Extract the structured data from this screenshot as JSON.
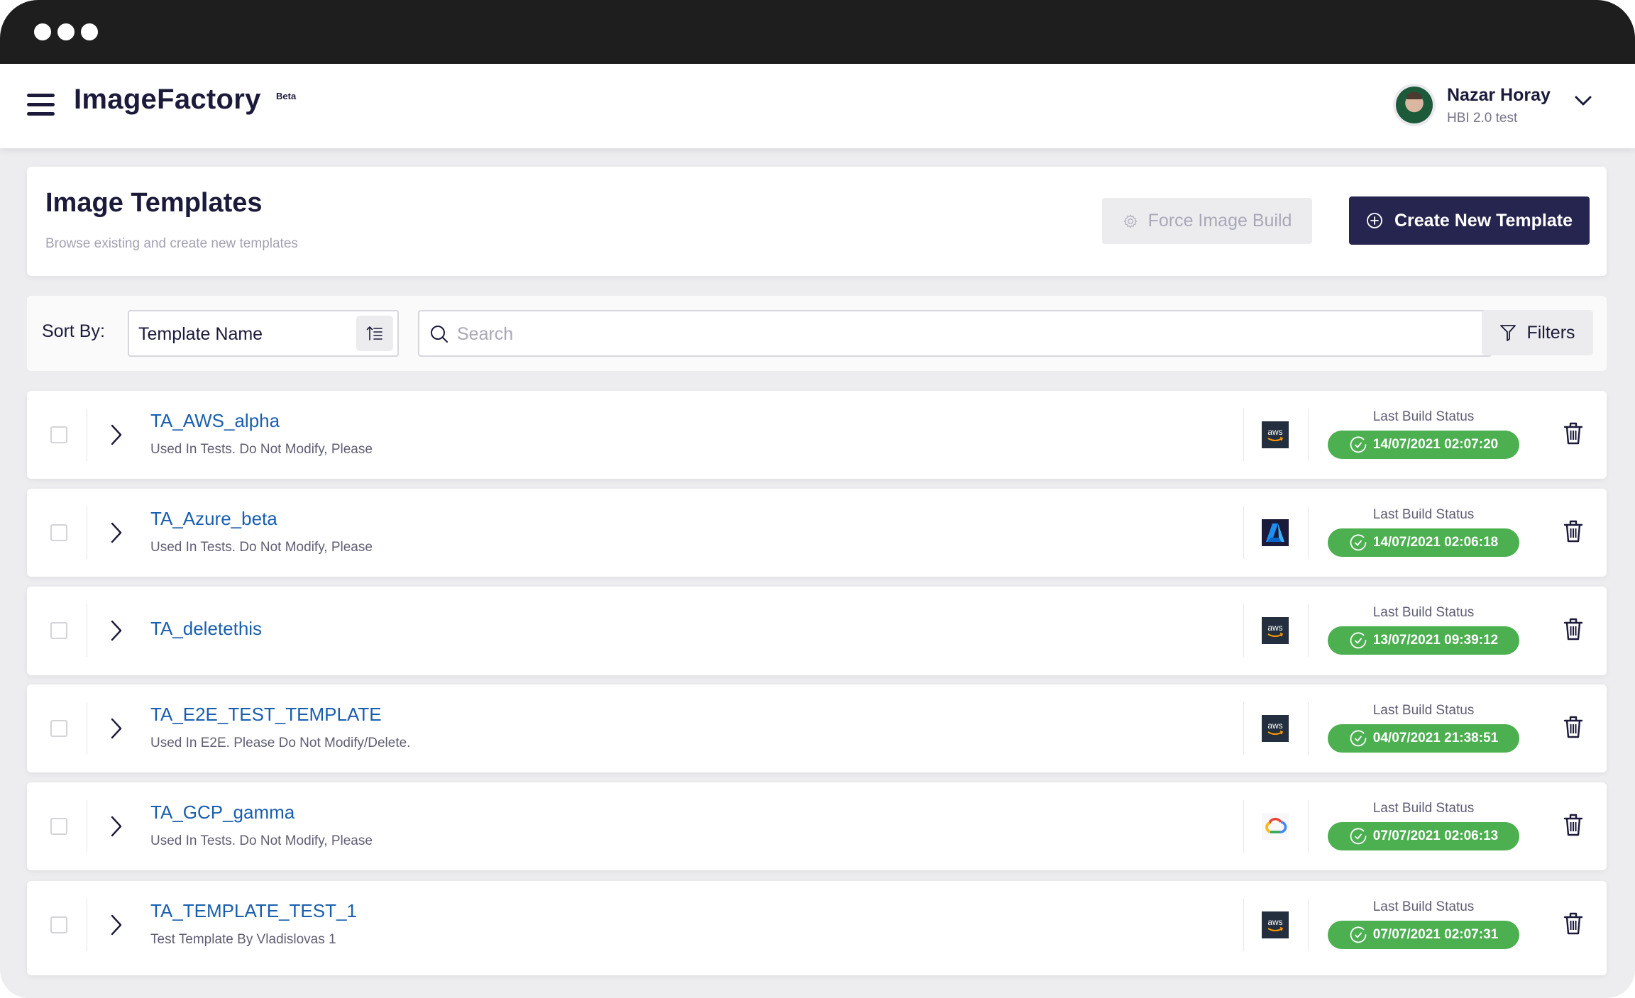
{
  "window": {
    "controls": [
      "window-dot",
      "window-dot",
      "window-dot"
    ]
  },
  "header": {
    "brand": "ImageFactory",
    "badge": "Beta",
    "user": {
      "name": "Nazar Horay",
      "org": "HBI 2.0 test"
    }
  },
  "page": {
    "title": "Image Templates",
    "subtitle": "Browse existing and create new templates",
    "force_build_label": "Force Image Build",
    "create_label": "Create New Template"
  },
  "toolbar": {
    "sort_label": "Sort By:",
    "sort_value": "Template Name",
    "search_placeholder": "Search",
    "search_value": "",
    "filters_label": "Filters"
  },
  "colors": {
    "primary": "#25254f",
    "link": "#1a5fae",
    "success": "#4caf50"
  },
  "templates": [
    {
      "name": "TA_AWS_alpha",
      "description": "Used In Tests. Do Not Modify, Please",
      "provider": "aws",
      "status_label": "Last Build Status",
      "last_build": "14/07/2021 02:07:20",
      "status": "success"
    },
    {
      "name": "TA_Azure_beta",
      "description": "Used In Tests. Do Not Modify, Please",
      "provider": "azure",
      "status_label": "Last Build Status",
      "last_build": "14/07/2021 02:06:18",
      "status": "success"
    },
    {
      "name": "TA_deletethis",
      "description": "",
      "provider": "aws",
      "status_label": "Last Build Status",
      "last_build": "13/07/2021 09:39:12",
      "status": "success"
    },
    {
      "name": "TA_E2E_TEST_TEMPLATE",
      "description": "Used In E2E. Please Do Not Modify/Delete.",
      "provider": "aws",
      "status_label": "Last Build Status",
      "last_build": "04/07/2021 21:38:51",
      "status": "success"
    },
    {
      "name": "TA_GCP_gamma",
      "description": "Used In Tests. Do Not Modify, Please",
      "provider": "gcp",
      "status_label": "Last Build Status",
      "last_build": "07/07/2021 02:06:13",
      "status": "success"
    },
    {
      "name": "TA_TEMPLATE_TEST_1",
      "description": "Test Template By Vladislovas 1",
      "provider": "aws",
      "status_label": "Last Build Status",
      "last_build": "07/07/2021 02:07:31",
      "status": "success"
    }
  ],
  "provider_labels": {
    "aws": "aws"
  }
}
